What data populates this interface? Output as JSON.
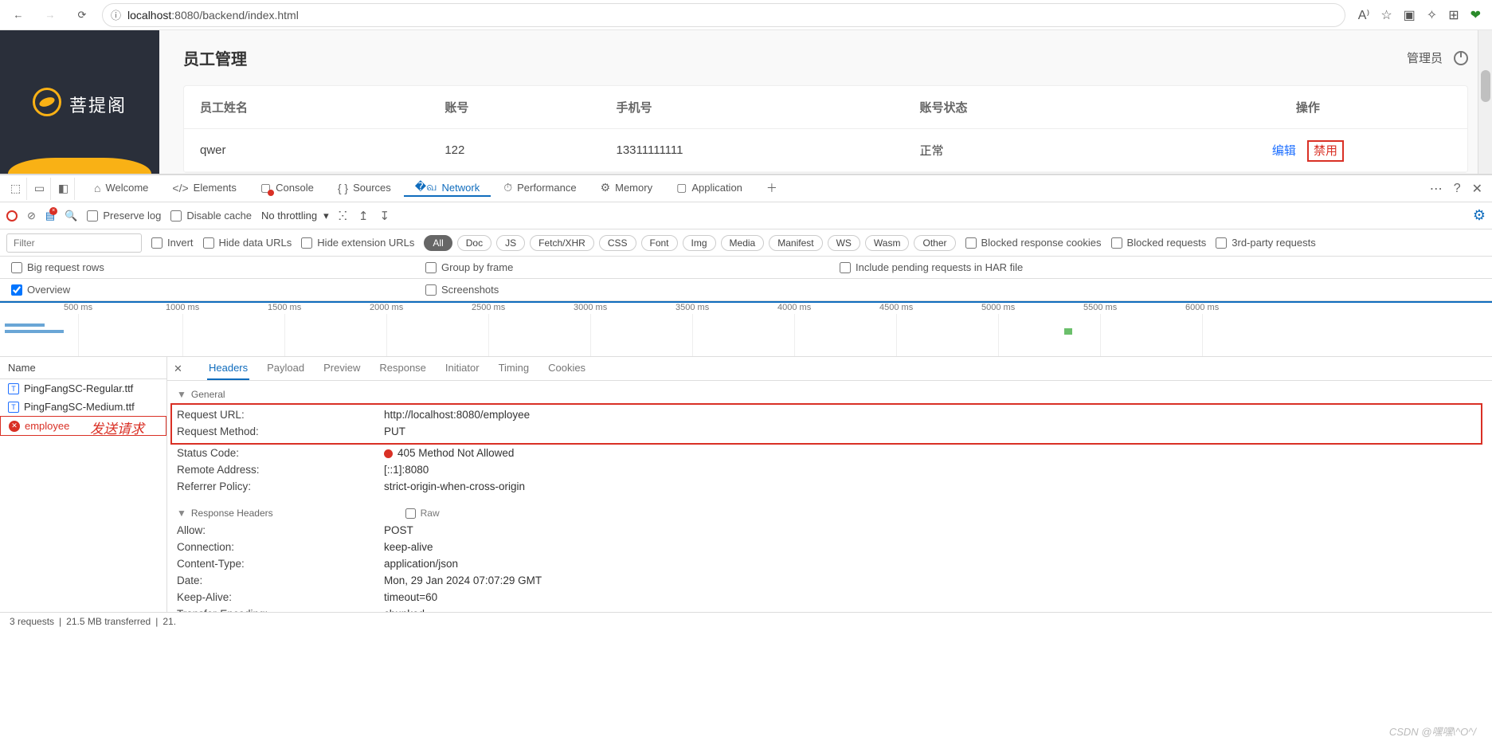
{
  "browser": {
    "url_prefix": "localhost",
    "url_rest": ":8080/backend/index.html"
  },
  "app": {
    "logo_text": "菩提阁",
    "title": "员工管理",
    "user_label": "管理员",
    "columns": {
      "name": "员工姓名",
      "account": "账号",
      "phone": "手机号",
      "status": "账号状态",
      "ops": "操作"
    },
    "rows": [
      {
        "name": "qwer",
        "account": "122",
        "phone": "13311111111",
        "status": "正常"
      }
    ],
    "op_edit": "编辑",
    "op_disable": "禁用"
  },
  "devtools": {
    "tabs": {
      "welcome": "Welcome",
      "elements": "Elements",
      "console": "Console",
      "sources": "Sources",
      "network": "Network",
      "performance": "Performance",
      "memory": "Memory",
      "application": "Application"
    },
    "toolbar": {
      "preserve": "Preserve log",
      "disable_cache": "Disable cache",
      "throttle": "No throttling"
    },
    "filter_placeholder": "Filter",
    "filters": {
      "invert": "Invert",
      "hide_data": "Hide data URLs",
      "hide_ext": "Hide extension URLs",
      "all": "All",
      "doc": "Doc",
      "js": "JS",
      "fetch": "Fetch/XHR",
      "css": "CSS",
      "font": "Font",
      "img": "Img",
      "media": "Media",
      "manifest": "Manifest",
      "ws": "WS",
      "wasm": "Wasm",
      "other": "Other",
      "blocked_cookies": "Blocked response cookies",
      "blocked_req": "Blocked requests",
      "third_party": "3rd-party requests"
    },
    "checks": {
      "big_rows": "Big request rows",
      "group_frame": "Group by frame",
      "overview": "Overview",
      "screenshots": "Screenshots",
      "include_har": "Include pending requests in HAR file"
    },
    "timeline_ticks": [
      "500 ms",
      "1000 ms",
      "1500 ms",
      "2000 ms",
      "2500 ms",
      "3000 ms",
      "3500 ms",
      "4000 ms",
      "4500 ms",
      "5000 ms",
      "5500 ms",
      "6000 ms"
    ],
    "name_header": "Name",
    "requests": [
      {
        "label": "PingFangSC-Regular.ttf",
        "err": false
      },
      {
        "label": "PingFangSC-Medium.ttf",
        "err": false
      },
      {
        "label": "employee",
        "err": true,
        "annot": "发送请求"
      }
    ],
    "detail_tabs": {
      "headers": "Headers",
      "payload": "Payload",
      "preview": "Preview",
      "response": "Response",
      "initiator": "Initiator",
      "timing": "Timing",
      "cookies": "Cookies"
    },
    "general_label": "General",
    "general": {
      "url_k": "Request URL:",
      "url_v": "http://localhost:8080/employee",
      "method_k": "Request Method:",
      "method_v": "PUT",
      "status_k": "Status Code:",
      "status_v": "405 Method Not Allowed",
      "remote_k": "Remote Address:",
      "remote_v": "[::1]:8080",
      "referrer_k": "Referrer Policy:",
      "referrer_v": "strict-origin-when-cross-origin"
    },
    "resp_label": "Response Headers",
    "raw_label": "Raw",
    "resp": {
      "allow_k": "Allow:",
      "allow_v": "POST",
      "conn_k": "Connection:",
      "conn_v": "keep-alive",
      "ct_k": "Content-Type:",
      "ct_v": "application/json",
      "date_k": "Date:",
      "date_v": "Mon, 29 Jan 2024 07:07:29 GMT",
      "ka_k": "Keep-Alive:",
      "ka_v": "timeout=60",
      "te_k": "Transfer-Encoding:",
      "te_v": "chunked"
    },
    "status_bar": {
      "reqs": "3 requests",
      "transfer": "21.5 MB transferred",
      "res": "21."
    }
  },
  "watermark": "CSDN @嘿嘿\\^O^/"
}
